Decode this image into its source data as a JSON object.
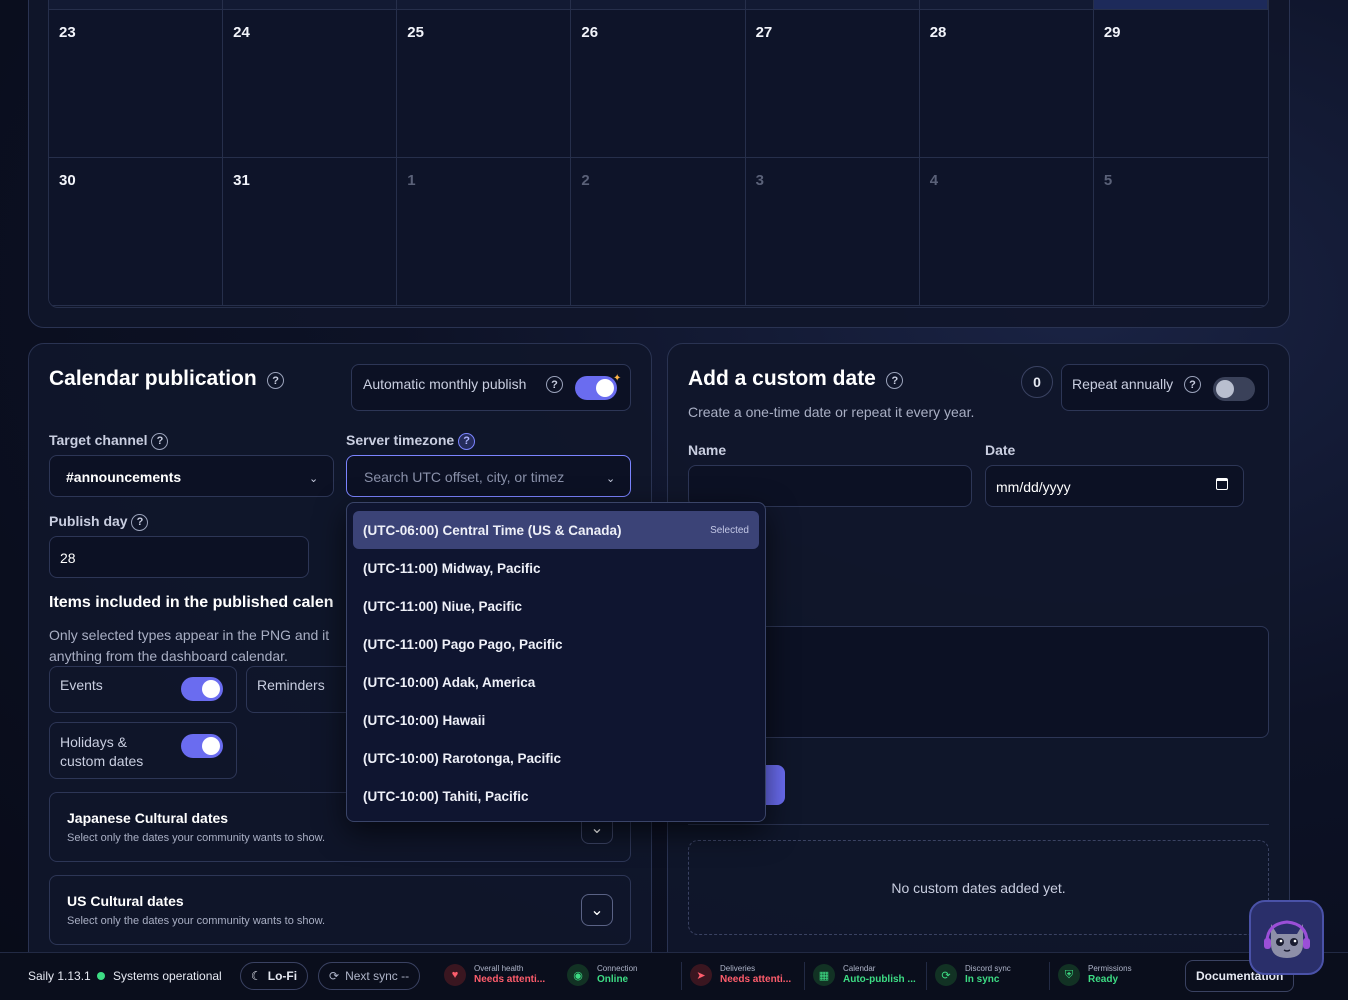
{
  "calendar": {
    "week1": [
      "23",
      "24",
      "25",
      "26",
      "27",
      "28",
      "29"
    ],
    "week2": [
      "30",
      "31",
      "1",
      "2",
      "3",
      "4",
      "5"
    ]
  },
  "publication": {
    "title": "Calendar publication",
    "auto_publish_label": "Automatic monthly publish",
    "auto_publish_on": true,
    "target_channel_label": "Target channel",
    "target_channel_value": "#announcements",
    "server_timezone_label": "Server timezone",
    "timezone_placeholder": "Search UTC offset, city, or timez",
    "publish_day_label": "Publish day",
    "publish_day_value": "28",
    "items_heading": "Items included in the published calen",
    "items_desc": "Only selected types appear in the PNG and it\nanything from the dashboard calendar.",
    "events_label": "Events",
    "reminders_label": "Reminders",
    "holidays_label": "Holidays &\ncustom dates",
    "jp_title": "Japanese Cultural dates",
    "jp_desc": "Select only the dates your community wants to show.",
    "us_title": "US Cultural dates",
    "us_desc": "Select only the dates your community wants to show."
  },
  "timezone_dropdown": {
    "selected_badge": "Selected",
    "options": [
      "(UTC-06:00) Central Time (US & Canada)",
      "(UTC-11:00) Midway, Pacific",
      "(UTC-11:00) Niue, Pacific",
      "(UTC-11:00) Pago Pago, Pacific",
      "(UTC-10:00) Adak, America",
      "(UTC-10:00) Hawaii",
      "(UTC-10:00) Rarotonga, Pacific",
      "(UTC-10:00) Tahiti, Pacific"
    ]
  },
  "custom_date": {
    "title": "Add a custom date",
    "count": "0",
    "repeat_label": "Repeat annually",
    "repeat_on": false,
    "subtitle": "Create a one-time date or repeat it every year.",
    "name_label": "Name",
    "date_label": "Date",
    "date_placeholder": "mm/dd/yyyy",
    "empty_text": "No custom dates added yet."
  },
  "statusbar": {
    "version": "Saily 1.13.1",
    "systems": "Systems operational",
    "lofi": "Lo-Fi",
    "next_sync": "Next sync --",
    "overall_label": "Overall health",
    "overall_value": "Needs attenti...",
    "connection_label": "Connection",
    "connection_value": "Online",
    "deliveries_label": "Deliveries",
    "deliveries_value": "Needs attenti...",
    "calendar_label": "Calendar",
    "calendar_value": "Auto-publish ...",
    "discord_label": "Discord sync",
    "discord_value": "In sync",
    "permissions_label": "Permissions",
    "permissions_value": "Ready",
    "documentation": "Documentation"
  },
  "colors": {
    "accent": "#6a6cf0",
    "ok": "#3ddc84",
    "warn": "#ff5d6c"
  }
}
